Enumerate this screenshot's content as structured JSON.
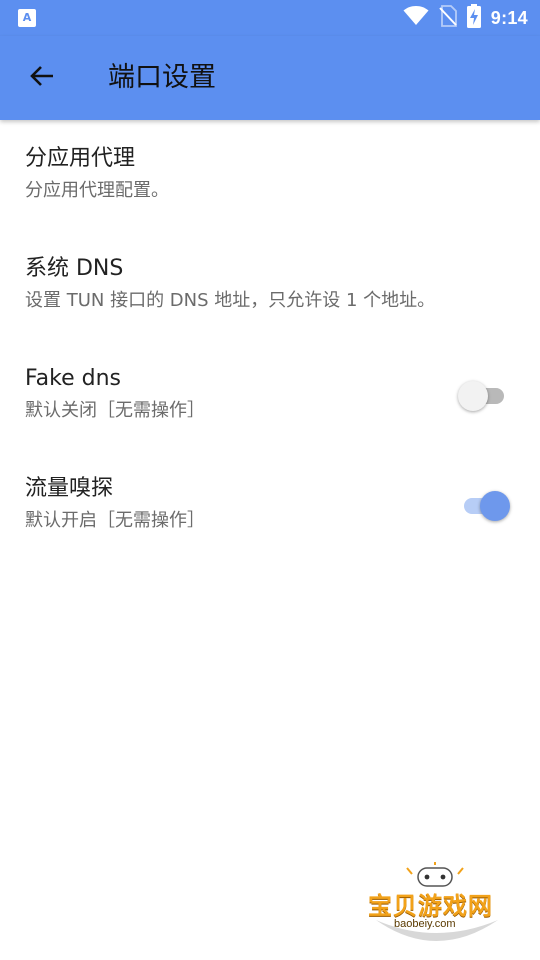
{
  "statusbar": {
    "time": "9:14",
    "notification_badge": "A",
    "icons": [
      "wifi-icon",
      "no-sim-icon",
      "battery-charging-icon"
    ]
  },
  "toolbar": {
    "title": "端口设置",
    "back_icon": "arrow-left-icon"
  },
  "settings": [
    {
      "title": "分应用代理",
      "subtitle": "分应用代理配置。"
    },
    {
      "title": "系统 DNS",
      "subtitle": "设置 TUN 接口的 DNS 地址，只允许设 1 个地址。"
    },
    {
      "title": "Fake dns",
      "subtitle": "默认关闭［无需操作］",
      "toggle": false
    },
    {
      "title": "流量嗅探",
      "subtitle": "默认开启［无需操作］",
      "toggle": true
    }
  ],
  "watermark": {
    "name": "宝贝游戏网",
    "url": "baobeiy.com"
  },
  "colors": {
    "primary": "#5c8ff0",
    "switch_on": "#6e98ec",
    "switch_off": "#b9b9b9"
  }
}
